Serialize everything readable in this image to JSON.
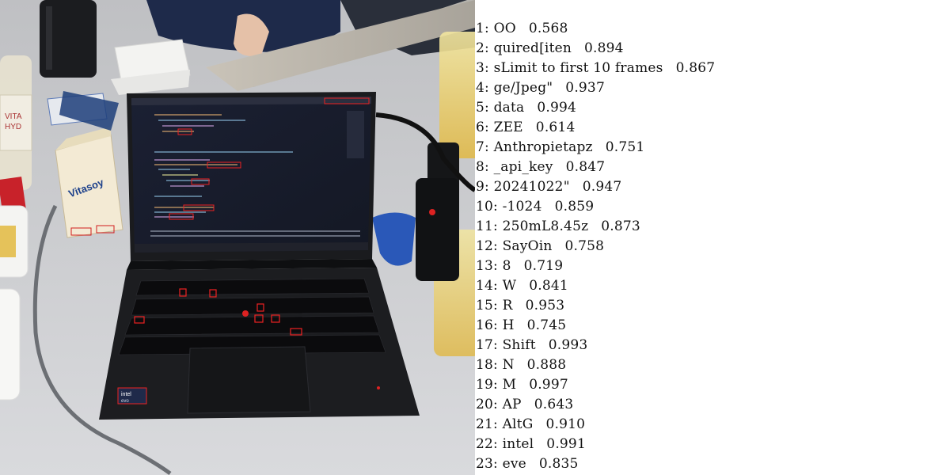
{
  "photo": {
    "screen_highlight_labels": [
      "TextBox_Cwop",
      "api_key",
      "20241022"
    ],
    "keyboard_highlight_labels": [
      "W",
      "R",
      "H",
      "Shift",
      "N",
      "M",
      "AltG"
    ],
    "sticker_labels": [
      "intel",
      "eve"
    ],
    "vitasoy_labels": [
      "Vitasoy",
      "250mL",
      "8.45z"
    ]
  },
  "ocr_results": [
    {
      "index": "1:",
      "text": "OO",
      "score": "0.568"
    },
    {
      "index": "2:",
      "text": "quired[iten",
      "score": "0.894"
    },
    {
      "index": "3:",
      "text": "sLimit to first 10 frames",
      "score": "0.867"
    },
    {
      "index": "4:",
      "text": "ge/Jpeg\"",
      "score": "0.937"
    },
    {
      "index": "5:",
      "text": "data",
      "score": "0.994"
    },
    {
      "index": "6:",
      "text": "ZEE",
      "score": "0.614"
    },
    {
      "index": "7:",
      "text": "Anthropietapz",
      "score": "0.751"
    },
    {
      "index": "8:",
      "text": "_api_key",
      "score": "0.847"
    },
    {
      "index": "9:",
      "text": "20241022\"",
      "score": "0.947"
    },
    {
      "index": "10:",
      "text": "-1024",
      "score": "0.859"
    },
    {
      "index": "11:",
      "text": "250mL8.45z",
      "score": "0.873"
    },
    {
      "index": "12:",
      "text": "SayOin",
      "score": "0.758"
    },
    {
      "index": "13:",
      "text": "8",
      "score": "0.719"
    },
    {
      "index": "14:",
      "text": "W",
      "score": "0.841"
    },
    {
      "index": "15:",
      "text": "R",
      "score": "0.953"
    },
    {
      "index": "16:",
      "text": "H",
      "score": "0.745"
    },
    {
      "index": "17:",
      "text": "Shift",
      "score": "0.993"
    },
    {
      "index": "18:",
      "text": "N",
      "score": "0.888"
    },
    {
      "index": "19:",
      "text": "M",
      "score": "0.997"
    },
    {
      "index": "20:",
      "text": "AP",
      "score": "0.643"
    },
    {
      "index": "21:",
      "text": "AltG",
      "score": "0.910"
    },
    {
      "index": "22:",
      "text": "intel",
      "score": "0.991"
    },
    {
      "index": "23:",
      "text": "eve",
      "score": "0.835"
    }
  ]
}
